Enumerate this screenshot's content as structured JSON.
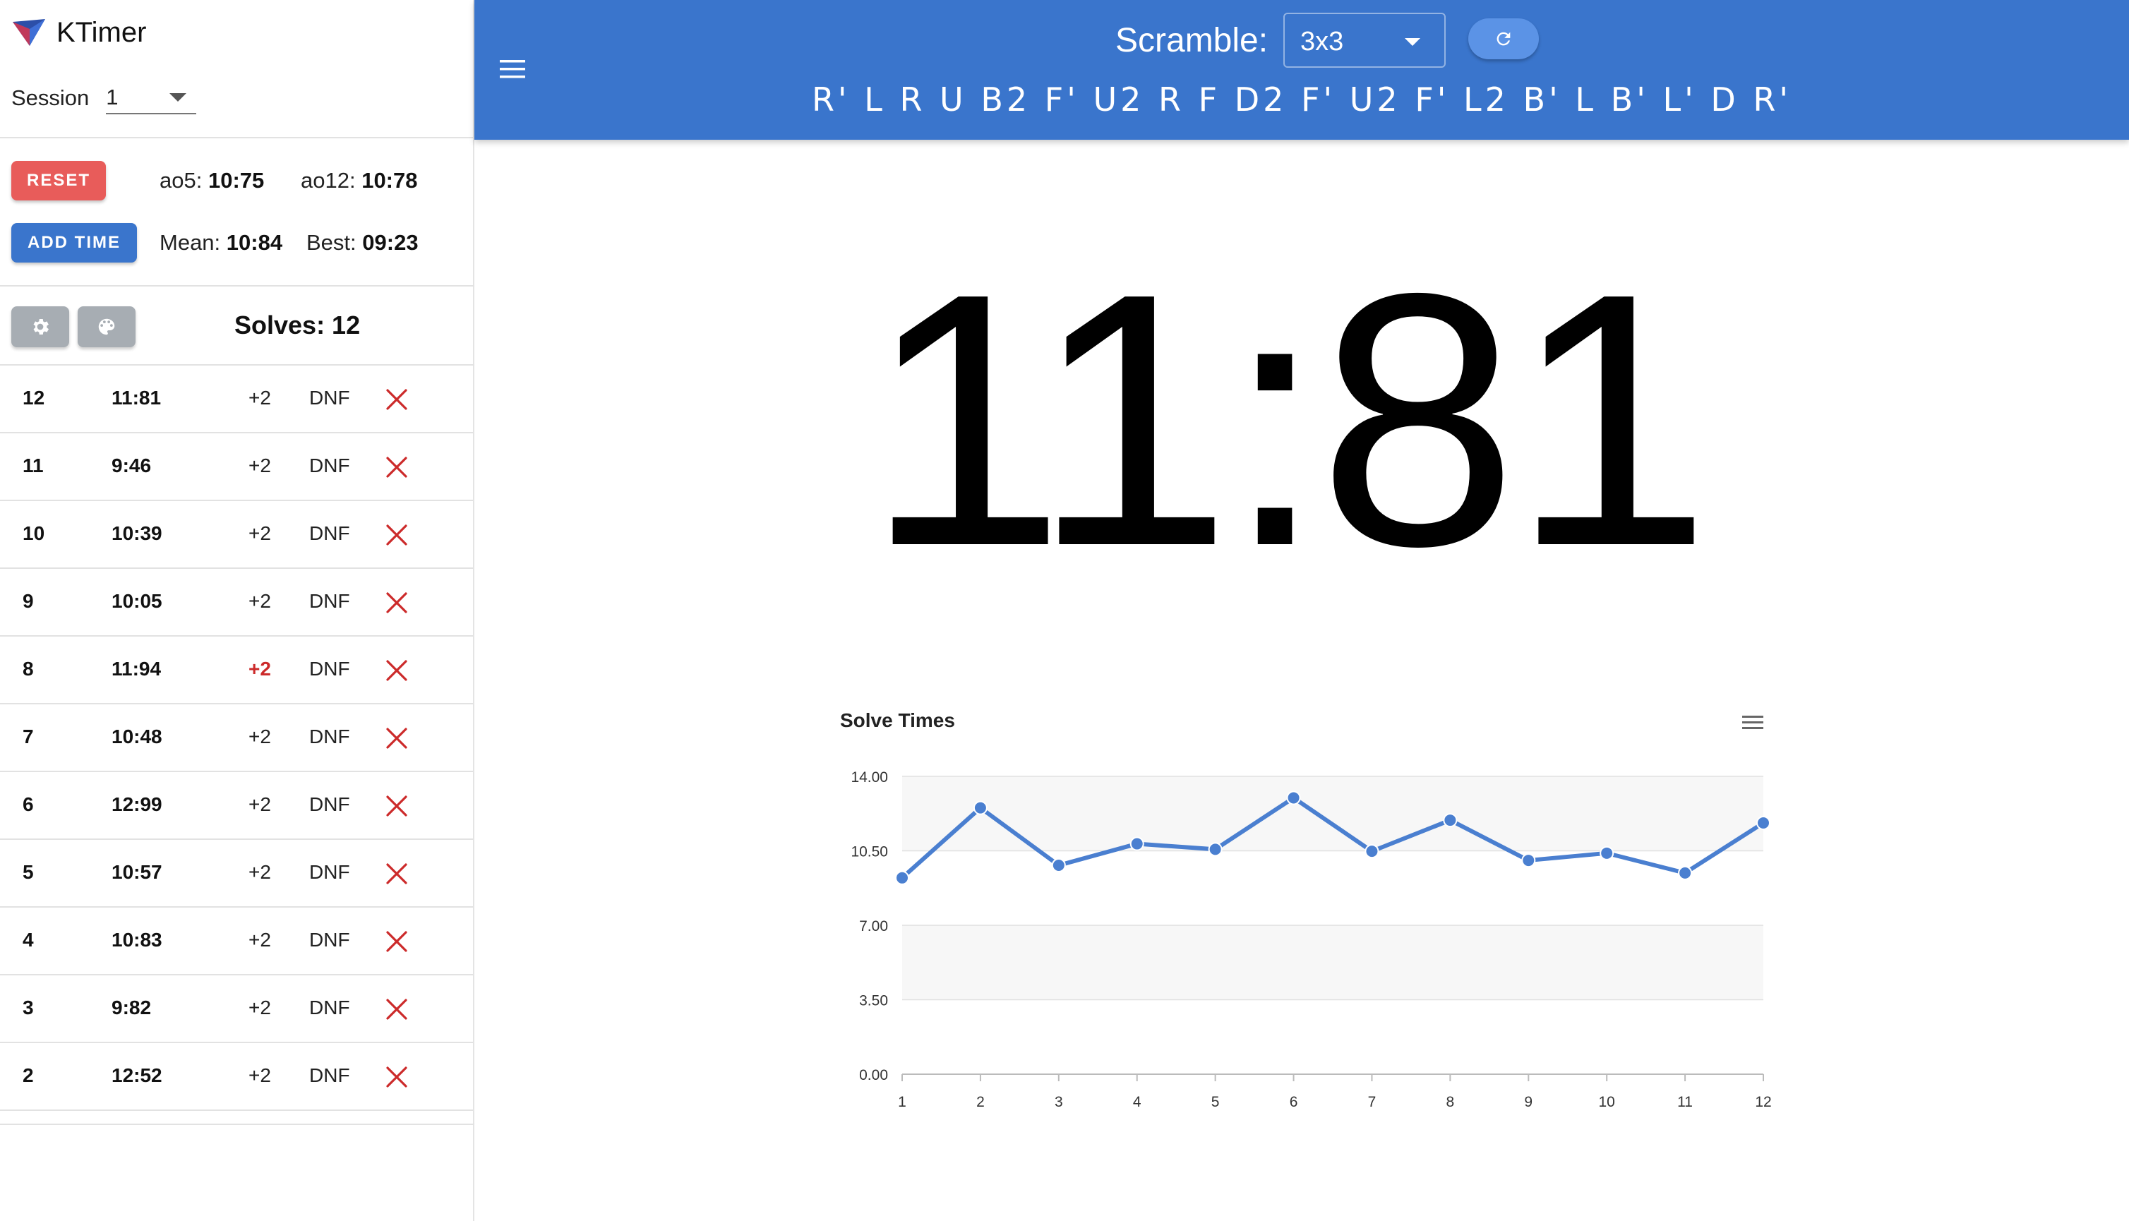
{
  "brand": {
    "title": "KTimer",
    "logo": "ktimer-logo"
  },
  "session": {
    "label": "Session",
    "value": "1"
  },
  "controls": {
    "reset_label": "RESET",
    "add_time_label": "ADD TIME"
  },
  "stats": {
    "ao5_label": "ao5:",
    "ao5_value": "10:75",
    "ao12_label": "ao12:",
    "ao12_value": "10:78",
    "mean_label": "Mean:",
    "mean_value": "10:84",
    "best_label": "Best:",
    "best_value": "09:23"
  },
  "solves_header": {
    "settings_icon": "gear-icon",
    "theme_icon": "palette-icon",
    "count_label": "Solves: 12"
  },
  "solves": [
    {
      "num": "12",
      "time": "11:81",
      "plus2": "+2",
      "plus2_active": false,
      "dnf": "DNF"
    },
    {
      "num": "11",
      "time": "9:46",
      "plus2": "+2",
      "plus2_active": false,
      "dnf": "DNF"
    },
    {
      "num": "10",
      "time": "10:39",
      "plus2": "+2",
      "plus2_active": false,
      "dnf": "DNF"
    },
    {
      "num": "9",
      "time": "10:05",
      "plus2": "+2",
      "plus2_active": false,
      "dnf": "DNF"
    },
    {
      "num": "8",
      "time": "11:94",
      "plus2": "+2",
      "plus2_active": true,
      "dnf": "DNF"
    },
    {
      "num": "7",
      "time": "10:48",
      "plus2": "+2",
      "plus2_active": false,
      "dnf": "DNF"
    },
    {
      "num": "6",
      "time": "12:99",
      "plus2": "+2",
      "plus2_active": false,
      "dnf": "DNF"
    },
    {
      "num": "5",
      "time": "10:57",
      "plus2": "+2",
      "plus2_active": false,
      "dnf": "DNF"
    },
    {
      "num": "4",
      "time": "10:83",
      "plus2": "+2",
      "plus2_active": false,
      "dnf": "DNF"
    },
    {
      "num": "3",
      "time": "9:82",
      "plus2": "+2",
      "plus2_active": false,
      "dnf": "DNF"
    },
    {
      "num": "2",
      "time": "12:52",
      "plus2": "+2",
      "plus2_active": false,
      "dnf": "DNF"
    }
  ],
  "appbar": {
    "menu_icon": "hamburger-menu-icon",
    "scramble_label": "Scramble:",
    "puzzle": "3x3",
    "refresh_icon": "refresh-icon",
    "scramble": "R' L R U B2 F' U2 R F D2 F' U2 F' L2 B' L B' L' D R'"
  },
  "timer": {
    "display": "11:81"
  },
  "colors": {
    "primary": "#3a75cc",
    "reset": "#e85c5a",
    "danger": "#cc2a2a",
    "series": "#4a7fd0"
  },
  "chart_data": {
    "type": "line",
    "title": "Solve Times",
    "menu_icon": "chart-menu-icon",
    "x": [
      1,
      2,
      3,
      4,
      5,
      6,
      7,
      8,
      9,
      10,
      11,
      12
    ],
    "categories": [
      "1",
      "2",
      "3",
      "4",
      "5",
      "6",
      "7",
      "8",
      "9",
      "10",
      "11",
      "12"
    ],
    "series": [
      {
        "values": [
          9.23,
          12.52,
          9.82,
          10.83,
          10.57,
          12.99,
          10.48,
          11.94,
          10.05,
          10.39,
          9.46,
          11.81
        ]
      }
    ],
    "yticks": [
      "0.00",
      "3.50",
      "7.00",
      "10.50",
      "14.00"
    ],
    "ylim": [
      0,
      14
    ],
    "grid": true,
    "legend": "none"
  }
}
